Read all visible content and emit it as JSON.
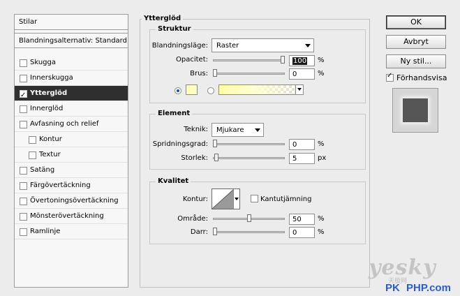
{
  "left": {
    "header": "Stilar",
    "blend_options": "Blandningsalternativ: Standard",
    "items": [
      {
        "label": "Skugga",
        "checked": false,
        "indent": false
      },
      {
        "label": "Innerskugga",
        "checked": false,
        "indent": false
      },
      {
        "label": "Ytterglöd",
        "checked": true,
        "indent": false,
        "selected": true
      },
      {
        "label": "Innerglöd",
        "checked": false,
        "indent": false
      },
      {
        "label": "Avfasning och relief",
        "checked": false,
        "indent": false
      },
      {
        "label": "Kontur",
        "checked": false,
        "indent": true
      },
      {
        "label": "Textur",
        "checked": false,
        "indent": true
      },
      {
        "label": "Satäng",
        "checked": false,
        "indent": false
      },
      {
        "label": "Färgövertäckning",
        "checked": false,
        "indent": false
      },
      {
        "label": "Övertoningsövertäckning",
        "checked": false,
        "indent": false
      },
      {
        "label": "Mönsterövertäckning",
        "checked": false,
        "indent": false
      },
      {
        "label": "Ramlinje",
        "checked": false,
        "indent": false
      }
    ]
  },
  "panel": {
    "title": "Ytterglöd",
    "struktur": {
      "title": "Struktur",
      "blend_mode_label": "Blandningsläge:",
      "blend_mode_value": "Raster",
      "opacity_label": "Opacitet:",
      "opacity_value": "100",
      "opacity_unit": "%",
      "opacity_level": 1.0,
      "noise_label": "Brus:",
      "noise_value": "0",
      "noise_unit": "%",
      "noise_level": 0.0,
      "glow_color": "#ffffc0"
    },
    "element": {
      "title": "Element",
      "technique_label": "Teknik:",
      "technique_value": "Mjukare",
      "spread_label": "Spridningsgrad:",
      "spread_value": "0",
      "spread_unit": "%",
      "spread_level": 0.0,
      "size_label": "Storlek:",
      "size_value": "5",
      "size_unit": "px",
      "size_level": 0.02
    },
    "kvalitet": {
      "title": "Kvalitet",
      "contour_label": "Kontur:",
      "antialias_label": "Kantutjämning",
      "range_label": "Område:",
      "range_value": "50",
      "range_unit": "%",
      "range_level": 0.5,
      "jitter_label": "Darr:",
      "jitter_value": "0",
      "jitter_unit": "%",
      "jitter_level": 0.0
    }
  },
  "buttons": {
    "ok": "OK",
    "cancel": "Avbryt",
    "new_style": "Ny stil...",
    "preview_label": "Förhandsvisa"
  },
  "watermark": {
    "line1": "yesky",
    "line2": "天极网",
    "line3": "PHP.com"
  }
}
